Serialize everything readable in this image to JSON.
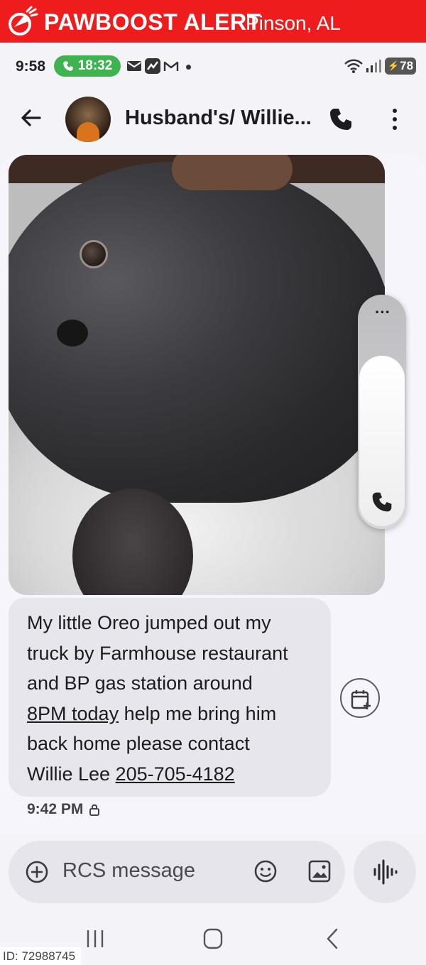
{
  "banner": {
    "brand": "PAWBOOST ALERT",
    "location": "Pinson, AL",
    "color": "#ee1c1c"
  },
  "status_bar": {
    "time": "9:58",
    "call_timer": "18:32",
    "battery": "78",
    "signal": "6"
  },
  "app_bar": {
    "contact_title": "Husband's/ Willie..."
  },
  "message": {
    "line1": "My little Oreo jumped out my",
    "line2": "truck by Farmhouse restaurant",
    "line3": "and BP gas station around",
    "time_link": "8PM today",
    "line4_rest": " help me bring him",
    "line5": "back home please contact",
    "line6_prefix": "Willie Lee ",
    "phone_link": "205-705-4182",
    "timestamp": "9:42 PM"
  },
  "composer": {
    "placeholder": "RCS message"
  },
  "footer": {
    "id_tag": "ID: 72988745"
  },
  "colors": {
    "accent": "#3fb34f",
    "bubble": "#e7e6ec",
    "background": "#f6f5fb"
  }
}
